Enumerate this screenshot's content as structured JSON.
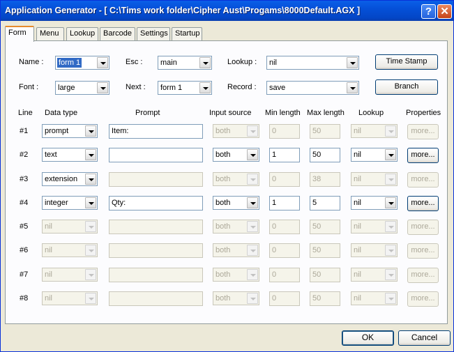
{
  "window": {
    "title": "Application Generator - [ C:\\Tims work folder\\Cipher Aust\\Progams\\8000Default.AGX ]",
    "help_glyph": "?",
    "close_glyph": "✕"
  },
  "tabs": [
    "Form",
    "Menu",
    "Lookup",
    "Barcode",
    "Settings",
    "Startup"
  ],
  "form": {
    "name_label": "Name :",
    "name_value": "form 1",
    "font_label": "Font :",
    "font_value": "large",
    "esc_label": "Esc :",
    "esc_value": "main",
    "next_label": "Next :",
    "next_value": "form 1",
    "lookup_label": "Lookup :",
    "lookup_value": "nil",
    "record_label": "Record :",
    "record_value": "save",
    "timestamp_button": "Time Stamp",
    "branch_button": "Branch"
  },
  "columns": {
    "line": "Line",
    "data_type": "Data type",
    "prompt": "Prompt",
    "input_source": "Input source",
    "min_length": "Min length",
    "max_length": "Max length",
    "lookup": "Lookup",
    "properties": "Properties"
  },
  "rows": [
    {
      "line": "#1",
      "data_type": "prompt",
      "prompt": "Item:",
      "input_source": "both",
      "min": "0",
      "max": "50",
      "lookup": "nil",
      "more": "more..."
    },
    {
      "line": "#2",
      "data_type": "text",
      "prompt": "",
      "input_source": "both",
      "min": "1",
      "max": "50",
      "lookup": "nil",
      "more": "more..."
    },
    {
      "line": "#3",
      "data_type": "extension",
      "prompt": "",
      "input_source": "both",
      "min": "0",
      "max": "38",
      "lookup": "nil",
      "more": "more..."
    },
    {
      "line": "#4",
      "data_type": "integer",
      "prompt": "Qty:",
      "input_source": "both",
      "min": "1",
      "max": "5",
      "lookup": "nil",
      "more": "more..."
    },
    {
      "line": "#5",
      "data_type": "nil",
      "prompt": "",
      "input_source": "both",
      "min": "0",
      "max": "50",
      "lookup": "nil",
      "more": "more..."
    },
    {
      "line": "#6",
      "data_type": "nil",
      "prompt": "",
      "input_source": "both",
      "min": "0",
      "max": "50",
      "lookup": "nil",
      "more": "more..."
    },
    {
      "line": "#7",
      "data_type": "nil",
      "prompt": "",
      "input_source": "both",
      "min": "0",
      "max": "50",
      "lookup": "nil",
      "more": "more..."
    },
    {
      "line": "#8",
      "data_type": "nil",
      "prompt": "",
      "input_source": "both",
      "min": "0",
      "max": "50",
      "lookup": "nil",
      "more": "more..."
    }
  ],
  "buttons": {
    "ok": "OK",
    "cancel": "Cancel"
  }
}
